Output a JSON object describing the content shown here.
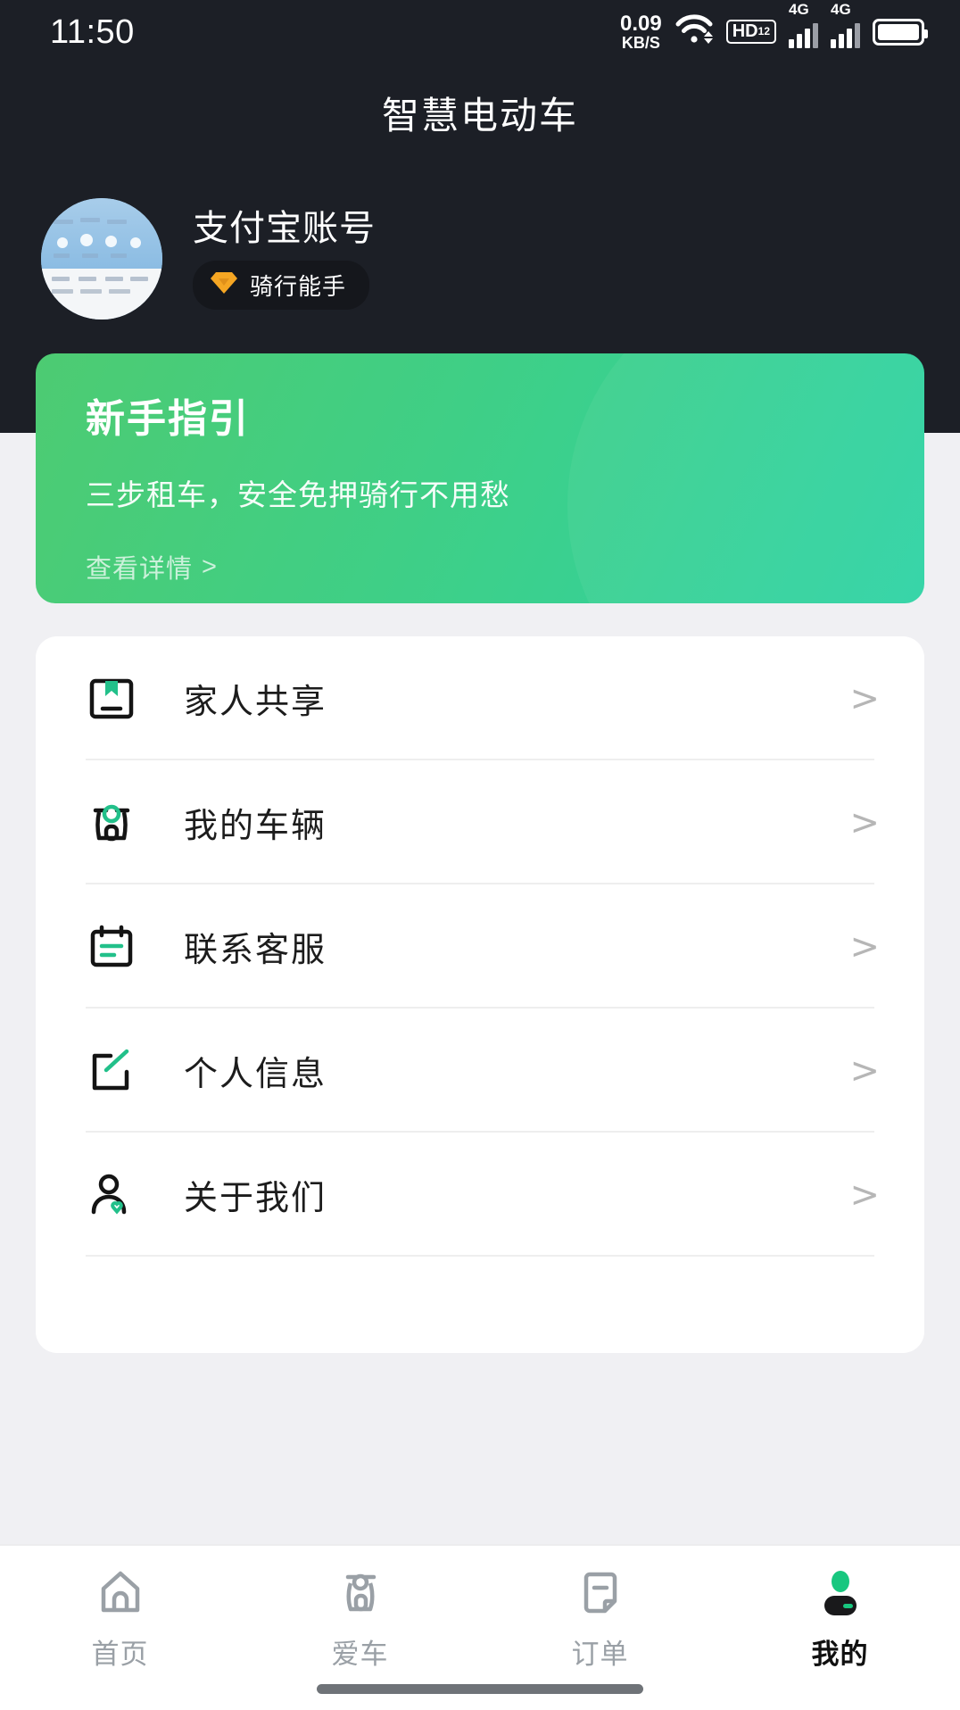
{
  "status_bar": {
    "time": "11:50",
    "net_speed_value": "0.09",
    "net_speed_unit": "KB/S",
    "wifi_icon": "wifi-icon",
    "hd_label": "HD",
    "hd_sup": "1",
    "hd_sub": "2",
    "sim1_network": "4G",
    "sim2_network": "4G",
    "battery_icon": "battery-icon"
  },
  "header": {
    "title": "智慧电动车"
  },
  "profile": {
    "avatar_name": "avatar",
    "name": "支付宝账号",
    "badge_label": "骑行能手",
    "badge_icon": "gem-icon",
    "badge_color": "#f5a623"
  },
  "guide_card": {
    "title": "新手指引",
    "subtitle": "三步租车，安全免押骑行不用愁",
    "link_label": "查看详情",
    "link_chevron": ">",
    "gradient_start": "#4dcb72",
    "gradient_end": "#2ed3a5"
  },
  "menu": {
    "chevron": ">",
    "accent_color": "#22c08a",
    "items": [
      {
        "label": "家人共享",
        "icon": "family-share-icon"
      },
      {
        "label": "我的车辆",
        "icon": "scooter-icon"
      },
      {
        "label": "联系客服",
        "icon": "customer-service-icon"
      },
      {
        "label": "个人信息",
        "icon": "edit-profile-icon"
      },
      {
        "label": "关于我们",
        "icon": "about-us-icon"
      }
    ]
  },
  "bottom_nav": {
    "items": [
      {
        "label": "首页",
        "icon": "home-icon",
        "active": false
      },
      {
        "label": "爱车",
        "icon": "scooter-icon",
        "active": false
      },
      {
        "label": "订单",
        "icon": "order-icon",
        "active": false
      },
      {
        "label": "我的",
        "icon": "profile-icon",
        "active": true
      }
    ],
    "inactive_color": "#9aa0a6",
    "active_color": "#101010",
    "active_icon_head_color": "#18c77f",
    "active_icon_body_color": "#19191b"
  }
}
